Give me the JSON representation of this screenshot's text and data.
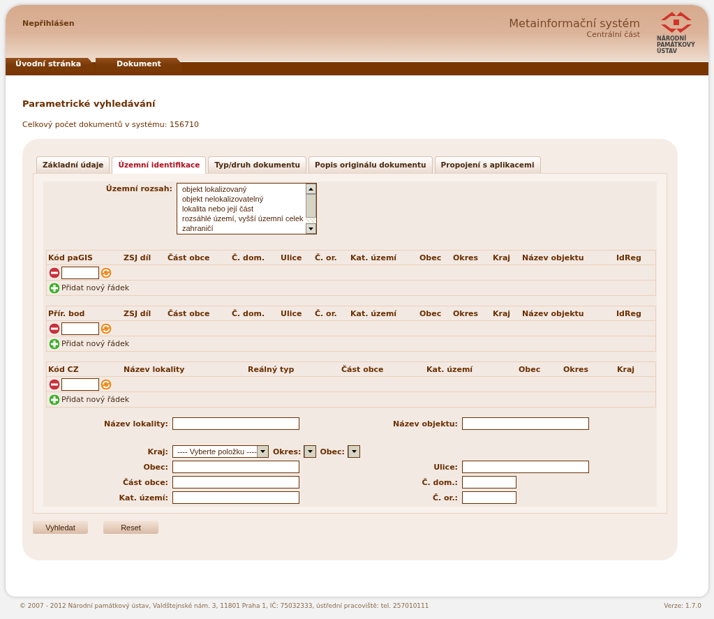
{
  "header": {
    "user_status": "Nepřihlášen",
    "system_title": "Metainformační systém",
    "system_subtitle": "Centrální část",
    "logo_lines": [
      "NÁRODNÍ",
      "PAMÁTKOVÝ",
      "ÚSTAV"
    ]
  },
  "nav_tabs": [
    {
      "label": "Úvodní stránka",
      "selected": false
    },
    {
      "label": "Dokument",
      "selected": false
    }
  ],
  "heading": "Parametrické vyhledávání",
  "document_count": "Celkový počet dokumentů v systému: 156710",
  "form_tabs": [
    {
      "label": "Základní údaje",
      "selected": false
    },
    {
      "label": "Územní identifikace",
      "selected": true
    },
    {
      "label": "Typ/druh dokumentu",
      "selected": false
    },
    {
      "label": "Popis originálu dokumentu",
      "selected": false
    },
    {
      "label": "Propojení s aplikacemi",
      "selected": false
    }
  ],
  "territorial_scope": {
    "label": "Územní rozsah:",
    "options": [
      {
        "label": "objekt lokalizovaný",
        "selected": false
      },
      {
        "label": "objekt nelokalizovatelný",
        "selected": false
      },
      {
        "label": "lokalita nebo její část",
        "selected": false
      },
      {
        "label": "rozsáhlé území, vyšší územní celek",
        "selected": false
      },
      {
        "label": "zahraničí",
        "selected": false
      }
    ]
  },
  "grids": [
    {
      "kind": "wide",
      "columns": [
        "Kód paGIS",
        "ZSJ díl",
        "Část obce",
        "Č. dom.",
        "Ulice",
        "Č. or.",
        "Kat. území",
        "Obec",
        "Okres",
        "Kraj",
        "Název objektu",
        "IdReg"
      ],
      "add_row": "Přidat nový řádek"
    },
    {
      "kind": "wide",
      "columns": [
        "Přír. bod",
        "ZSJ díl",
        "Část obce",
        "Č. dom.",
        "Ulice",
        "Č. or.",
        "Kat. území",
        "Obec",
        "Okres",
        "Kraj",
        "Název objektu",
        "IdReg"
      ],
      "add_row": "Přidat nový řádek"
    },
    {
      "kind": "locality",
      "columns": [
        "Kód CZ",
        "Název lokality",
        "Reálný typ",
        "Část obce",
        "Kat. území",
        "Obec",
        "Okres",
        "Kraj"
      ],
      "add_row": "Přidat nový řádek"
    }
  ],
  "form_sections": [
    [
      {
        "left": {
          "kind": "text",
          "label": "Název lokality:"
        },
        "right": {
          "kind": "text",
          "label": "Název objektu:"
        }
      }
    ],
    [
      {
        "left": {
          "kind": "selects",
          "label": "Kraj:",
          "value": "---- Vyberte položku ----",
          "more": [
            "Okres:",
            "Obec:"
          ]
        }
      },
      {
        "left": {
          "kind": "text",
          "label": "Obec:"
        },
        "right": {
          "kind": "text",
          "label": "Ulice:"
        }
      },
      {
        "left": {
          "kind": "text",
          "label": "Část obce:"
        },
        "right": {
          "kind": "short-text",
          "label": "Č. dom.:"
        }
      },
      {
        "left": {
          "kind": "text",
          "label": "Kat. území:"
        },
        "right": {
          "kind": "short-text",
          "label": "Č. or.:"
        }
      }
    ]
  ],
  "buttons": [
    "Vyhledat",
    "Reset"
  ],
  "footer": {
    "copyright": "© 2007 - 2012 Národní památkový ústav, Valdštejnské nám. 3, 11801 Praha 1, IČ: 75032333, ústřední pracoviště: tel. 257010111",
    "version": "Verze: 1.7.0"
  }
}
